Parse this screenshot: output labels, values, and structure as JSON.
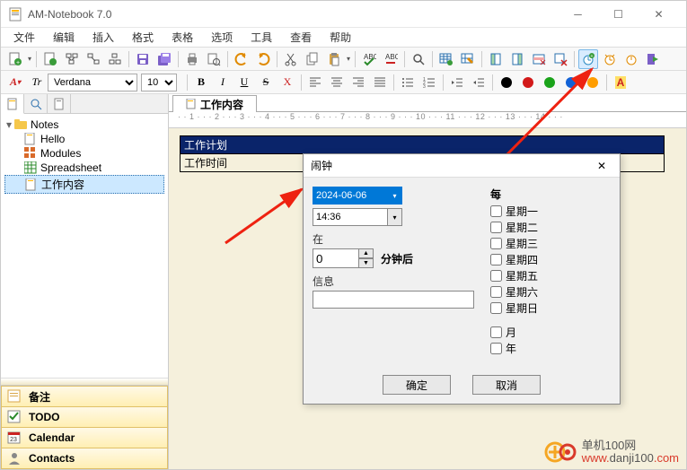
{
  "title": "AM-Notebook  7.0",
  "menu": [
    "文件",
    "编辑",
    "插入",
    "格式",
    "表格",
    "选项",
    "工具",
    "查看",
    "帮助"
  ],
  "toolbar1_icons": [
    "file-plus",
    "file-dropdown",
    "file-star",
    "tree-add",
    "tree-link",
    "save",
    "save-all",
    "print",
    "print-preview",
    "undo",
    "redo",
    "cut",
    "copy",
    "paste",
    "paste-dropdown",
    "spellcheck",
    "spellcheck-toggle",
    "table-insert",
    "table-edit",
    "column-left",
    "column-right",
    "row-delete",
    "table-delete",
    "alarm-add",
    "alarm",
    "alarm-set",
    "exit"
  ],
  "font_name": "Verdana",
  "font_size": "10",
  "fmt_buttons": [
    "B",
    "I",
    "U",
    "S",
    "X"
  ],
  "color_dots": [
    "#000000",
    "#d21919",
    "#1aa31a",
    "#1262d6",
    "#ff9d00"
  ],
  "tree_root": "Notes",
  "tree_items": [
    {
      "icon": "note",
      "label": "Hello"
    },
    {
      "icon": "modules",
      "label": "Modules"
    },
    {
      "icon": "sheet",
      "label": "Spreadsheet"
    },
    {
      "icon": "note",
      "label": "工作内容",
      "selected": true
    }
  ],
  "bottom_panels": [
    {
      "icon": "memo",
      "label": "备注"
    },
    {
      "icon": "todo",
      "label": "TODO"
    },
    {
      "icon": "cal",
      "label": "Calendar"
    },
    {
      "icon": "contact",
      "label": "Contacts"
    }
  ],
  "doc_tab": "工作内容",
  "ruler": " · · 1 · · · 2 · · · 3 · · · 4 · · · 5 · · · 6 · · · 7 · · · 8 · · · 9 · · · 10 · · · 11 · · · 12 · · · 13 · · · 14 · · ·",
  "doc_rows": [
    "工作计划",
    "工作时间"
  ],
  "dialog": {
    "title": "闹钟",
    "date": "2024-06-06",
    "time": "14:36",
    "at_label": "在",
    "minutes_after": "分钟后",
    "minutes_value": "0",
    "info_label": "信息",
    "every_label": "每",
    "weekdays": [
      "星期一",
      "星期二",
      "星期三",
      "星期四",
      "星期五",
      "星期六",
      "星期日"
    ],
    "month": "月",
    "year": "年",
    "ok": "确定",
    "cancel": "取消"
  },
  "watermark": {
    "line1": "单机100网",
    "line2": "www.danji100.com"
  }
}
